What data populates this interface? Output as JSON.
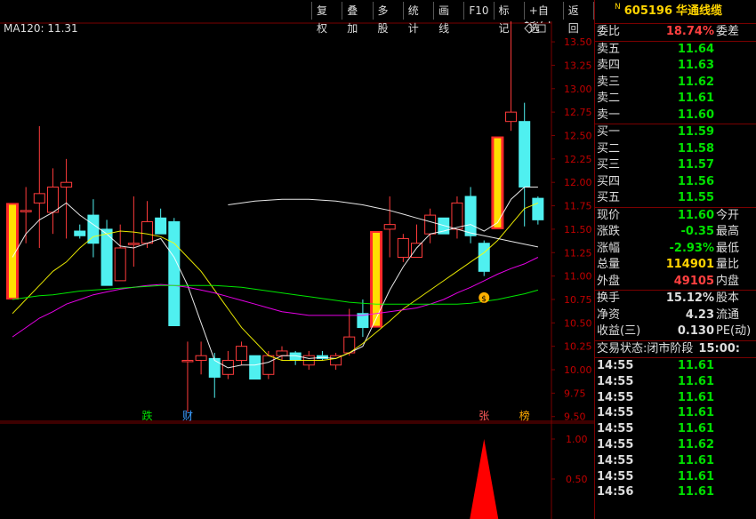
{
  "toolbar": {
    "items": [
      "复权",
      "叠加",
      "多股",
      "统计",
      "画线",
      "F10",
      "标记",
      "+自选",
      "返回"
    ]
  },
  "indicator": {
    "ma_label": "MA120: 11.31"
  },
  "chart_data": {
    "type": "candlestick",
    "yticks": [
      "13.50",
      "13.25",
      "13.00",
      "12.75",
      "12.50",
      "12.25",
      "12.00",
      "11.75",
      "11.50",
      "11.25",
      "11.00",
      "10.75",
      "10.50",
      "10.25",
      "10.00",
      "9.75",
      "9.50"
    ],
    "ylim": [
      9.45,
      13.7
    ],
    "high_label": "13.74",
    "candles": [
      {
        "o": 10.75,
        "h": 11.78,
        "l": 10.75,
        "c": 11.78
      },
      {
        "o": 11.7,
        "h": 11.95,
        "l": 11.35,
        "c": 11.7
      },
      {
        "o": 11.78,
        "h": 12.6,
        "l": 11.3,
        "c": 11.88
      },
      {
        "o": 11.68,
        "h": 12.15,
        "l": 11.45,
        "c": 11.95
      },
      {
        "o": 11.95,
        "h": 12.25,
        "l": 11.4,
        "c": 12.0
      },
      {
        "o": 11.48,
        "h": 11.55,
        "l": 11.4,
        "c": 11.43
      },
      {
        "o": 11.65,
        "h": 11.82,
        "l": 11.2,
        "c": 11.35
      },
      {
        "o": 11.5,
        "h": 11.6,
        "l": 10.9,
        "c": 10.9
      },
      {
        "o": 10.95,
        "h": 11.55,
        "l": 10.95,
        "c": 11.3
      },
      {
        "o": 11.35,
        "h": 11.85,
        "l": 11.1,
        "c": 11.35
      },
      {
        "o": 11.35,
        "h": 11.8,
        "l": 11.3,
        "c": 11.58
      },
      {
        "o": 11.62,
        "h": 11.72,
        "l": 11.48,
        "c": 11.45
      },
      {
        "o": 11.58,
        "h": 11.62,
        "l": 10.5,
        "c": 10.47
      },
      {
        "o": 10.1,
        "h": 10.3,
        "l": 9.55,
        "c": 10.1
      },
      {
        "o": 10.1,
        "h": 10.3,
        "l": 9.95,
        "c": 10.15
      },
      {
        "o": 10.12,
        "h": 10.18,
        "l": 9.7,
        "c": 9.92
      },
      {
        "o": 9.95,
        "h": 10.2,
        "l": 9.9,
        "c": 10.1
      },
      {
        "o": 10.1,
        "h": 10.3,
        "l": 10.05,
        "c": 10.25
      },
      {
        "o": 10.15,
        "h": 10.15,
        "l": 9.9,
        "c": 9.9
      },
      {
        "o": 9.95,
        "h": 10.2,
        "l": 9.9,
        "c": 10.15
      },
      {
        "o": 10.15,
        "h": 10.25,
        "l": 10.1,
        "c": 10.2
      },
      {
        "o": 10.18,
        "h": 10.2,
        "l": 10.05,
        "c": 10.1
      },
      {
        "o": 10.05,
        "h": 10.2,
        "l": 10.0,
        "c": 10.15
      },
      {
        "o": 10.15,
        "h": 10.2,
        "l": 10.1,
        "c": 10.12
      },
      {
        "o": 10.05,
        "h": 10.18,
        "l": 10.0,
        "c": 10.15
      },
      {
        "o": 10.18,
        "h": 10.65,
        "l": 10.15,
        "c": 10.35
      },
      {
        "o": 10.6,
        "h": 10.75,
        "l": 10.35,
        "c": 10.45
      },
      {
        "o": 10.45,
        "h": 11.48,
        "l": 10.45,
        "c": 11.48
      },
      {
        "o": 11.5,
        "h": 11.85,
        "l": 11.2,
        "c": 11.55
      },
      {
        "o": 11.2,
        "h": 11.45,
        "l": 11.15,
        "c": 11.4
      },
      {
        "o": 11.2,
        "h": 11.55,
        "l": 11.2,
        "c": 11.35
      },
      {
        "o": 11.45,
        "h": 11.72,
        "l": 11.35,
        "c": 11.65
      },
      {
        "o": 11.62,
        "h": 11.62,
        "l": 11.45,
        "c": 11.45
      },
      {
        "o": 11.5,
        "h": 11.85,
        "l": 11.4,
        "c": 11.78
      },
      {
        "o": 11.85,
        "h": 11.95,
        "l": 11.35,
        "c": 11.43
      },
      {
        "o": 11.35,
        "h": 11.38,
        "l": 11.0,
        "c": 11.05
      },
      {
        "o": 11.5,
        "h": 12.55,
        "l": 11.5,
        "c": 12.49
      },
      {
        "o": 12.65,
        "h": 13.74,
        "l": 12.55,
        "c": 12.75
      },
      {
        "o": 12.65,
        "h": 12.85,
        "l": 11.53,
        "c": 11.95
      },
      {
        "o": 11.83,
        "h": 11.85,
        "l": 11.55,
        "c": 11.6
      }
    ],
    "ma_series": [
      {
        "name": "MA5",
        "color": "#ffffff",
        "values": [
          11.2,
          11.45,
          11.6,
          11.68,
          11.78,
          11.65,
          11.55,
          11.45,
          11.32,
          11.3,
          11.35,
          11.4,
          11.2,
          10.9,
          10.5,
          10.1,
          10.02,
          10.05,
          10.05,
          10.08,
          10.15,
          10.15,
          10.12,
          10.13,
          10.12,
          10.18,
          10.25,
          10.55,
          10.85,
          11.1,
          11.3,
          11.45,
          11.48,
          11.52,
          11.55,
          11.48,
          11.57,
          11.82,
          11.95,
          11.95
        ]
      },
      {
        "name": "MA10",
        "color": "#ffff00",
        "values": [
          10.6,
          10.75,
          10.9,
          11.05,
          11.15,
          11.3,
          11.42,
          11.45,
          11.48,
          11.47,
          11.45,
          11.42,
          11.35,
          11.2,
          11.05,
          10.85,
          10.65,
          10.45,
          10.3,
          10.15,
          10.1,
          10.1,
          10.1,
          10.1,
          10.12,
          10.18,
          10.28,
          10.4,
          10.52,
          10.65,
          10.75,
          10.85,
          10.95,
          11.05,
          11.15,
          11.25,
          11.38,
          11.55,
          11.72,
          11.78
        ]
      },
      {
        "name": "MA20",
        "color": "#ff00ff",
        "values": [
          10.35,
          10.45,
          10.55,
          10.62,
          10.7,
          10.75,
          10.8,
          10.83,
          10.86,
          10.88,
          10.9,
          10.91,
          10.9,
          10.88,
          10.85,
          10.82,
          10.78,
          10.74,
          10.7,
          10.66,
          10.62,
          10.6,
          10.58,
          10.58,
          10.58,
          10.58,
          10.58,
          10.6,
          10.62,
          10.64,
          10.66,
          10.7,
          10.75,
          10.82,
          10.88,
          10.95,
          11.02,
          11.08,
          11.13,
          11.2
        ]
      },
      {
        "name": "MA60",
        "color": "#00ff00",
        "values": [
          10.75,
          10.77,
          10.79,
          10.8,
          10.82,
          10.84,
          10.85,
          10.86,
          10.87,
          10.88,
          10.89,
          10.9,
          10.9,
          10.9,
          10.9,
          10.9,
          10.89,
          10.88,
          10.86,
          10.84,
          10.82,
          10.8,
          10.78,
          10.76,
          10.74,
          10.72,
          10.71,
          10.7,
          10.7,
          10.7,
          10.7,
          10.7,
          10.7,
          10.7,
          10.71,
          10.73,
          10.75,
          10.78,
          10.81,
          10.85
        ]
      },
      {
        "name": "MA120",
        "color": "#ffffff",
        "values": [
          null,
          null,
          null,
          null,
          null,
          null,
          null,
          null,
          null,
          null,
          null,
          null,
          null,
          null,
          null,
          null,
          11.76,
          11.78,
          11.8,
          11.81,
          11.82,
          11.82,
          11.82,
          11.81,
          11.8,
          11.78,
          11.76,
          11.73,
          11.7,
          11.66,
          11.62,
          11.58,
          11.54,
          11.5,
          11.46,
          11.43,
          11.4,
          11.37,
          11.34,
          11.31
        ]
      }
    ],
    "yellow_bars": [
      0,
      27,
      36
    ],
    "markers": [
      {
        "index": 10,
        "text": "跌",
        "color": "#00e000"
      },
      {
        "index": 13,
        "text": "财",
        "color": "#3a9cff"
      },
      {
        "index": 35,
        "text": "张",
        "color": "#ff5a5a"
      },
      {
        "index": 38,
        "text": "榜",
        "color": "#ffaa00"
      }
    ],
    "coin_marker": {
      "index": 35,
      "value": 10.77,
      "text": "$"
    },
    "sub_yticks": [
      "1.00",
      "0.50"
    ],
    "sub_ylim": [
      0,
      1.2
    ],
    "sub_spike": {
      "index": 35,
      "value": 1.0,
      "color": "#ff0000"
    }
  },
  "quote": {
    "badge": "N",
    "code": "605196",
    "name": "华通线缆",
    "wei": {
      "label": "委比",
      "value": "18.74%",
      "tail": "委差"
    },
    "asks": [
      {
        "label": "卖五",
        "price": "11.64"
      },
      {
        "label": "卖四",
        "price": "11.63"
      },
      {
        "label": "卖三",
        "price": "11.62"
      },
      {
        "label": "卖二",
        "price": "11.61"
      },
      {
        "label": "卖一",
        "price": "11.60"
      }
    ],
    "bids": [
      {
        "label": "买一",
        "price": "11.59"
      },
      {
        "label": "买二",
        "price": "11.58"
      },
      {
        "label": "买三",
        "price": "11.57"
      },
      {
        "label": "买四",
        "price": "11.56"
      },
      {
        "label": "买五",
        "price": "11.55"
      }
    ],
    "stats1": [
      {
        "label": "现价",
        "value": "11.60",
        "color": "green",
        "tail": "今开"
      },
      {
        "label": "涨跌",
        "value": "-0.35",
        "color": "green",
        "tail": "最高"
      },
      {
        "label": "涨幅",
        "value": "-2.93%",
        "color": "green",
        "tail": "最低"
      },
      {
        "label": "总量",
        "value": "114901",
        "color": "yellow",
        "tail": "量比"
      },
      {
        "label": "外盘",
        "value": "49105",
        "color": "red",
        "tail": "内盘"
      }
    ],
    "stats2": [
      {
        "label": "换手",
        "value": "15.12%",
        "color": "white",
        "tail": "股本"
      },
      {
        "label": "净资",
        "value": "4.23",
        "color": "white",
        "tail": "流通"
      },
      {
        "label": "收益(三)",
        "value": "0.130",
        "color": "white",
        "tail": "PE(动)"
      }
    ],
    "status": {
      "label": "交易状态:",
      "value": "闭市阶段",
      "time": "15:00:"
    },
    "ticks": [
      {
        "time": "14:55",
        "price": "11.61"
      },
      {
        "time": "14:55",
        "price": "11.61"
      },
      {
        "time": "14:55",
        "price": "11.61"
      },
      {
        "time": "14:55",
        "price": "11.61"
      },
      {
        "time": "14:55",
        "price": "11.61"
      },
      {
        "time": "14:55",
        "price": "11.62"
      },
      {
        "time": "14:55",
        "price": "11.61"
      },
      {
        "time": "14:55",
        "price": "11.61"
      },
      {
        "time": "14:56",
        "price": "11.61"
      }
    ]
  }
}
